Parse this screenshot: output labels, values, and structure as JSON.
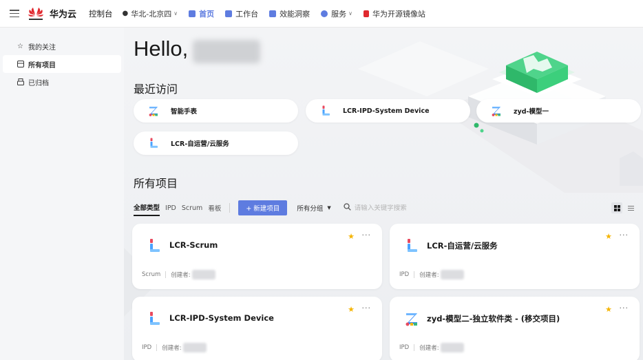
{
  "topbar": {
    "brand": "华为云",
    "console": "控制台",
    "region": "华北-北京四",
    "nav": [
      {
        "label": "首页",
        "icon": "home-icon",
        "color": "#5e7ce0"
      },
      {
        "label": "工作台",
        "icon": "workbench-icon",
        "color": "#5e7ce0"
      },
      {
        "label": "效能洞察",
        "icon": "insight-icon",
        "color": "#5e7ce0"
      },
      {
        "label": "服务",
        "icon": "service-icon",
        "color": "#5e7ce0"
      },
      {
        "label": "华为开源镜像站",
        "icon": "mirror-icon",
        "color": "#e0292f"
      }
    ]
  },
  "sidebar": {
    "items": [
      {
        "label": "我的关注",
        "icon": "star-outline-icon"
      },
      {
        "label": "所有项目",
        "icon": "folder-icon"
      },
      {
        "label": "已归档",
        "icon": "archive-icon"
      }
    ]
  },
  "main": {
    "greeting": "Hello,",
    "recent_title": "最近访问",
    "recent": [
      {
        "label": "智能手表",
        "icon": "z-project-icon"
      },
      {
        "label": "LCR-IPD-System Device",
        "icon": "l-project-icon"
      },
      {
        "label": "zyd-模型一",
        "icon": "z-project-icon"
      },
      {
        "label": "LCR-自运营/云服务",
        "icon": "l-project-icon"
      }
    ],
    "all_title": "所有项目",
    "filters": [
      "全部类型",
      "IPD",
      "Scrum",
      "看板"
    ],
    "new_button": "+ 新建项目",
    "group_select": "所有分组",
    "search_placeholder": "请输入关键字搜索",
    "creator_label": "创建者:",
    "projects": [
      {
        "name": "LCR-Scrum",
        "type": "Scrum",
        "icon": "l-project-icon"
      },
      {
        "name": "LCR-自运营/云服务",
        "type": "IPD",
        "icon": "l-project-icon"
      },
      {
        "name": "LCR-IPD-System Device",
        "type": "IPD",
        "icon": "l-project-icon"
      },
      {
        "name": "zyd-模型二-独立软件类 - (移交项目)",
        "type": "IPD",
        "icon": "z-project-icon"
      }
    ]
  },
  "colors": {
    "accent": "#5e7ce0",
    "star": "#f5b400",
    "brand_red": "#e0292f"
  }
}
